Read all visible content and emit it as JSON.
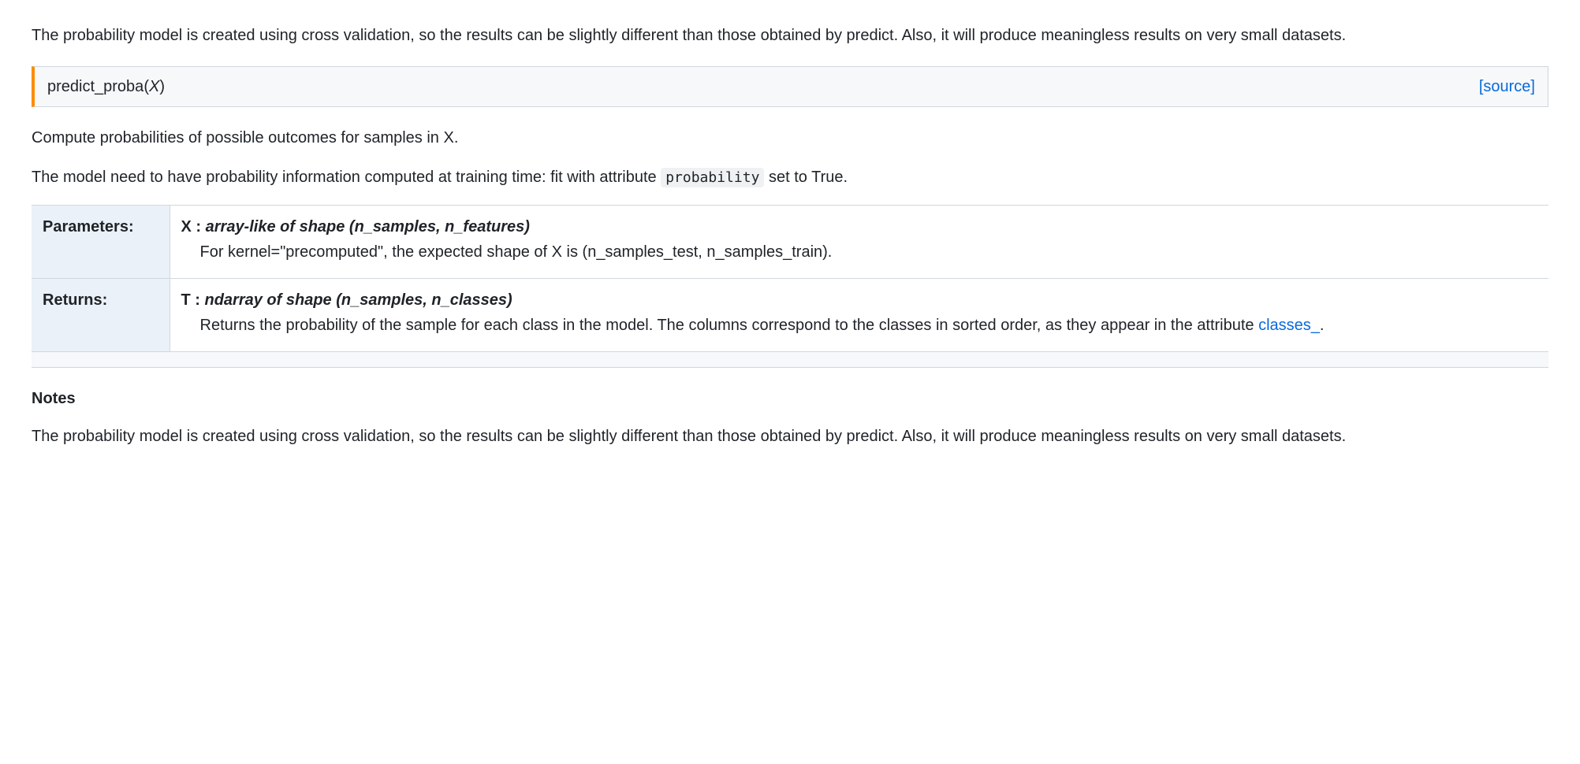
{
  "intro_text": "The probability model is created using cross validation, so the results can be slightly different than those obtained by predict. Also, it will produce meaningless results on very small datasets.",
  "method": {
    "name": "predict_proba",
    "open_paren": "(",
    "param": "X",
    "close_paren": ")",
    "source_link": "[source]"
  },
  "description1": "Compute probabilities of possible outcomes for samples in X.",
  "description2_prefix": "The model need to have probability information computed at training time: fit with attribute ",
  "description2_code": "probability",
  "description2_suffix": " set to True.",
  "parameters": {
    "label": "Parameters:",
    "item": {
      "name": "X",
      "sep": " : ",
      "type": "array-like of shape (n_samples, n_features)",
      "desc": "For kernel=\"precomputed\", the expected shape of X is (n_samples_test, n_samples_train)."
    }
  },
  "returns": {
    "label": "Returns:",
    "item": {
      "name": "T",
      "sep": " : ",
      "type": "ndarray of shape (n_samples, n_classes)",
      "desc_prefix": "Returns the probability of the sample for each class in the model. The columns correspond to the classes in sorted order, as they appear in the attribute ",
      "desc_link": "classes_",
      "desc_suffix": "."
    }
  },
  "notes": {
    "heading": "Notes",
    "text": "The probability model is created using cross validation, so the results can be slightly different than those obtained by predict. Also, it will produce meaningless results on very small datasets."
  }
}
